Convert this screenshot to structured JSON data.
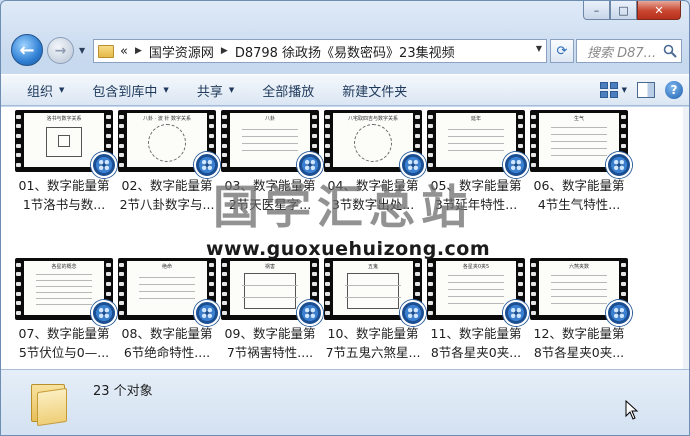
{
  "window": {
    "controls": {
      "minimize": "–",
      "maximize": "□",
      "close": "✕"
    }
  },
  "nav": {
    "back_icon": "←",
    "forward_icon": "→",
    "breadcrumbs": [
      "国学资源网",
      "D8798 徐政扬《易数密码》23集视频"
    ],
    "search_placeholder": "搜索 D87..."
  },
  "toolbar": {
    "organize": "组织",
    "include_library": "包含到库中",
    "share": "共享",
    "play_all": "全部播放",
    "new_folder": "新建文件夹",
    "help": "?"
  },
  "files": [
    {
      "line1": "01、数字能量第",
      "line2": "1节洛书与数...",
      "thumb": "洛书与数字关系"
    },
    {
      "line1": "02、数字能量第",
      "line2": "2节八卦数字与...",
      "thumb": "八卦 · 波 针 数字关系"
    },
    {
      "line1": "03、数字能量第",
      "line2": "2节天医星字...",
      "thumb": "八卦"
    },
    {
      "line1": "04、数字能量第",
      "line2": "3节数字出处...",
      "thumb": "八宅取四吉与数字关系"
    },
    {
      "line1": "05、数字能量第",
      "line2": "3节延年特性...",
      "thumb": "延年"
    },
    {
      "line1": "06、数字能量第",
      "line2": "4节生气特性...",
      "thumb": "生气"
    },
    {
      "line1": "07、数字能量第",
      "line2": "5节伏位与0—...",
      "thumb": "各星的概念"
    },
    {
      "line1": "08、数字能量第",
      "line2": "6节绝命特性....",
      "thumb": "绝命"
    },
    {
      "line1": "09、数字能量第",
      "line2": "7节祸害特性....",
      "thumb": "祸害"
    },
    {
      "line1": "10、数字能量第",
      "line2": "7节五鬼六煞星...",
      "thumb": "五鬼"
    },
    {
      "line1": "11、数字能量第",
      "line2": "8节各星夹0夹...",
      "thumb": "各星夹0夹5"
    },
    {
      "line1": "12、数字能量第",
      "line2": "8节各星夹0夹...",
      "thumb": "六煞夹数"
    }
  ],
  "watermark": {
    "title": "国学汇总站",
    "url": "www.guoxuehuizong.com"
  },
  "status": {
    "count": "23 个对象"
  }
}
